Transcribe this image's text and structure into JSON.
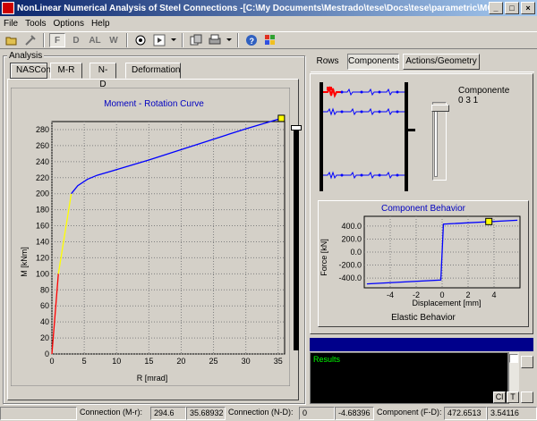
{
  "window": {
    "title": "NonLinear Numerical Analysis of Steel Connections -[C:\\My Documents\\Mestrado\\tese\\Docs\\tese\\parametric\\MCS\\...",
    "buttons": {
      "minimize": "_",
      "restore": "□",
      "close": "×"
    }
  },
  "menu": [
    "File",
    "Tools",
    "Options",
    "Help"
  ],
  "toolbar": {
    "btn_F": "F",
    "btn_D": "D",
    "btn_AL": "AL",
    "btn_W": "W"
  },
  "analysis": {
    "group_label": "Analysis",
    "tabs": [
      "NASCon",
      "M-R",
      "N-D",
      "Deformation"
    ],
    "active_tab": "NASCon"
  },
  "right_tabs": {
    "tabs": [
      "Rows",
      "Components",
      "Actions/Geometry"
    ],
    "active": "Components"
  },
  "component": {
    "label": "Componente",
    "value": "0 3 1"
  },
  "moment_chart": {
    "chart_data": {
      "type": "line",
      "title": "Moment - Rotation Curve",
      "xlabel": "R [mrad]",
      "ylabel": "M [kNm]",
      "xlim": [
        0,
        36
      ],
      "ylim": [
        0,
        290
      ],
      "xticks": [
        0,
        5,
        10,
        15,
        20,
        25,
        30,
        35
      ],
      "yticks": [
        0,
        20,
        40,
        60,
        80,
        100,
        120,
        140,
        160,
        180,
        200,
        220,
        240,
        260,
        280
      ],
      "grid": true,
      "series": [
        {
          "color": "#ff0000",
          "x": [
            0,
            0.5,
            1.0
          ],
          "y": [
            0,
            50,
            100
          ]
        },
        {
          "color": "#ffff00",
          "x": [
            1.0,
            3.0
          ],
          "y": [
            100,
            200
          ]
        },
        {
          "color": "#0000ff",
          "x": [
            3.0,
            4.0,
            5.5,
            7.0,
            10,
            15,
            20,
            25,
            30,
            35.5
          ],
          "y": [
            200,
            210,
            218,
            223,
            230,
            242,
            255,
            268,
            281,
            294
          ]
        }
      ],
      "marker": {
        "x": 35.5,
        "y": 294,
        "color": "#ffff00"
      }
    }
  },
  "component_chart": {
    "chart_data": {
      "type": "line",
      "title": "Component Behavior",
      "xlabel": "Displacement [mm]",
      "ylabel": "Force [kN]",
      "xlim": [
        -6,
        6
      ],
      "ylim": [
        -550,
        550
      ],
      "xticks": [
        -4,
        -2,
        0,
        2,
        4
      ],
      "yticks": [
        400.0,
        200.0,
        0.0,
        -200.0,
        -400.0
      ],
      "ytick_labels": [
        "400.0",
        "200.0",
        "0.0",
        "-200.0",
        "-400.0"
      ],
      "grid": true,
      "series": [
        {
          "color": "#0000ff",
          "x": [
            -5.8,
            -0.1,
            0.1,
            5.8
          ],
          "y": [
            -490,
            -430,
            430,
            490
          ]
        }
      ],
      "marker": {
        "x": 3.6,
        "y": 470,
        "color": "#ffff00"
      }
    },
    "caption": "Elastic Behavior"
  },
  "results": {
    "label": "Results",
    "btn_cl": "Cl",
    "btn_t": "T"
  },
  "status": {
    "conn_mr_label": "Connection (M-r):",
    "conn_mr_v1": "294.6",
    "conn_mr_v2": "35.68932",
    "conn_nd_label": "Connection (N-D):",
    "conn_nd_v1": "0",
    "conn_nd_v2": "-4.68396",
    "comp_fd_label": "Component (F-D):",
    "comp_fd_v1": "472.6513",
    "comp_fd_v2": "3.54116"
  },
  "colors": {
    "chart_blue": "#0000ff",
    "title_blue": "#0000c0",
    "results_bar": "#00008b",
    "results_text": "#00ff00"
  }
}
